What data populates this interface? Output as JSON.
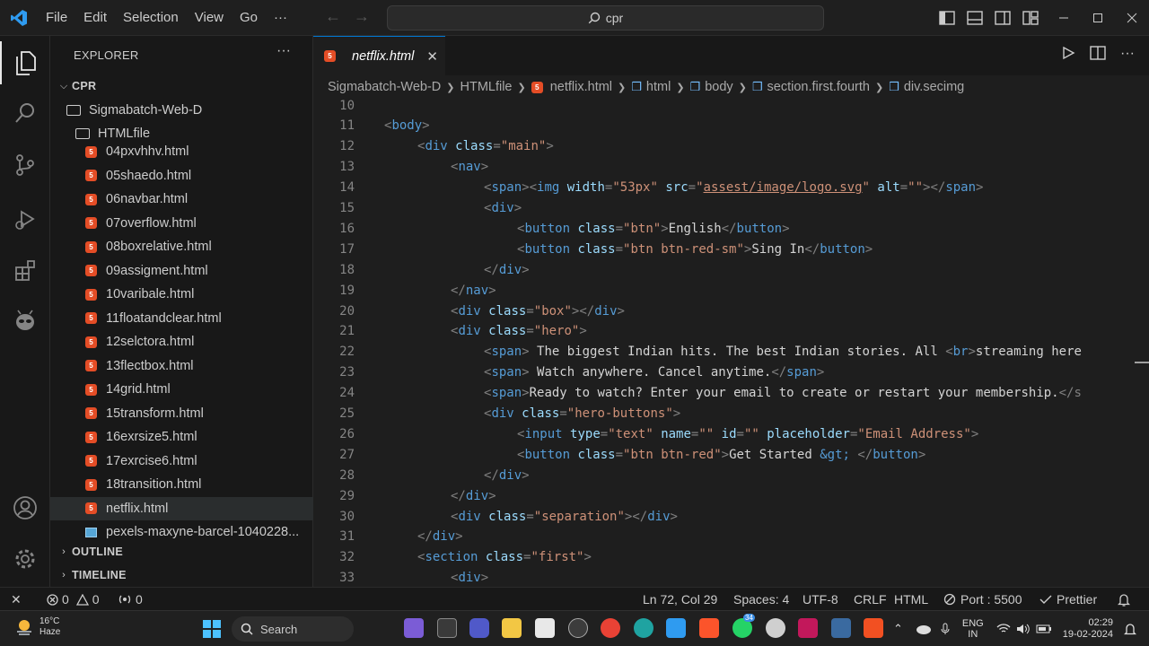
{
  "titlebar": {
    "menu": [
      "File",
      "Edit",
      "Selection",
      "View",
      "Go",
      "···"
    ],
    "search_text": "cpr",
    "back_glyph": "←",
    "forward_glyph": "→"
  },
  "sidebar": {
    "title": "EXPLORER",
    "more_glyph": "···",
    "root": "CPR",
    "folder": "Sigmabatch-Web-D",
    "subfolder": "HTMLfile",
    "files": [
      "04pxvhhv.html",
      "05shaedo.html",
      "06navbar.html",
      "07overflow.html",
      "08boxrelative.html",
      "09assigment.html",
      "10varibale.html",
      "11floatandclear.html",
      "12selctora.html",
      "13flectbox.html",
      "14grid.html",
      "15transform.html",
      "16exrsize5.html",
      "17exrcise6.html",
      "18transition.html",
      "netflix.html"
    ],
    "image_file": "pexels-maxyne-barcel-1040228...",
    "outline": "OUTLINE",
    "timeline": "TIMELINE"
  },
  "editor": {
    "tab_name": "netflix.html",
    "tab_close": "✕",
    "breadcrumb": [
      "Sigmabatch-Web-D",
      "HTMLfile",
      "netflix.html",
      "html",
      "body",
      "section.first.fourth",
      "div.secimg"
    ],
    "lines": [
      {
        "n": "10",
        "indent": 0,
        "segs": []
      },
      {
        "n": "11",
        "indent": 0,
        "segs": [
          [
            "p",
            "<"
          ],
          [
            "t",
            "body"
          ],
          [
            "p",
            ">"
          ]
        ]
      },
      {
        "n": "12",
        "indent": 1,
        "segs": [
          [
            "p",
            "<"
          ],
          [
            "t",
            "div"
          ],
          [
            "w",
            " "
          ],
          [
            "a",
            "class"
          ],
          [
            "p",
            "="
          ],
          [
            "s",
            "\"main\""
          ],
          [
            "p",
            ">"
          ]
        ]
      },
      {
        "n": "13",
        "indent": 2,
        "segs": [
          [
            "p",
            "<"
          ],
          [
            "t",
            "nav"
          ],
          [
            "p",
            ">"
          ]
        ]
      },
      {
        "n": "14",
        "indent": 3,
        "segs": [
          [
            "p",
            "<"
          ],
          [
            "t",
            "span"
          ],
          [
            "p",
            "><"
          ],
          [
            "t",
            "img"
          ],
          [
            "w",
            " "
          ],
          [
            "a",
            "width"
          ],
          [
            "p",
            "="
          ],
          [
            "s",
            "\"53px\""
          ],
          [
            "w",
            " "
          ],
          [
            "a",
            "src"
          ],
          [
            "p",
            "="
          ],
          [
            "s",
            "\""
          ],
          [
            "u",
            "assest/image/logo.svg"
          ],
          [
            "s",
            "\""
          ],
          [
            "w",
            " "
          ],
          [
            "a",
            "alt"
          ],
          [
            "p",
            "="
          ],
          [
            "s",
            "\"\""
          ],
          [
            "p",
            "></"
          ],
          [
            "t",
            "span"
          ],
          [
            "p",
            ">"
          ]
        ]
      },
      {
        "n": "15",
        "indent": 3,
        "segs": [
          [
            "p",
            "<"
          ],
          [
            "t",
            "div"
          ],
          [
            "p",
            ">"
          ]
        ]
      },
      {
        "n": "16",
        "indent": 4,
        "segs": [
          [
            "p",
            "<"
          ],
          [
            "t",
            "button"
          ],
          [
            "w",
            " "
          ],
          [
            "a",
            "class"
          ],
          [
            "p",
            "="
          ],
          [
            "s",
            "\"btn\""
          ],
          [
            "p",
            ">"
          ],
          [
            "w",
            "English"
          ],
          [
            "p",
            "</"
          ],
          [
            "t",
            "button"
          ],
          [
            "p",
            ">"
          ]
        ]
      },
      {
        "n": "17",
        "indent": 4,
        "segs": [
          [
            "p",
            "<"
          ],
          [
            "t",
            "button"
          ],
          [
            "w",
            " "
          ],
          [
            "a",
            "class"
          ],
          [
            "p",
            "="
          ],
          [
            "s",
            "\"btn btn-red-sm\""
          ],
          [
            "p",
            ">"
          ],
          [
            "w",
            "Sing In"
          ],
          [
            "p",
            "</"
          ],
          [
            "t",
            "button"
          ],
          [
            "p",
            ">"
          ]
        ]
      },
      {
        "n": "18",
        "indent": 3,
        "segs": [
          [
            "p",
            "</"
          ],
          [
            "t",
            "div"
          ],
          [
            "p",
            ">"
          ]
        ]
      },
      {
        "n": "19",
        "indent": 2,
        "segs": [
          [
            "p",
            "</"
          ],
          [
            "t",
            "nav"
          ],
          [
            "p",
            ">"
          ]
        ]
      },
      {
        "n": "20",
        "indent": 2,
        "segs": [
          [
            "p",
            "<"
          ],
          [
            "t",
            "div"
          ],
          [
            "w",
            " "
          ],
          [
            "a",
            "class"
          ],
          [
            "p",
            "="
          ],
          [
            "s",
            "\"box\""
          ],
          [
            "p",
            "></"
          ],
          [
            "t",
            "div"
          ],
          [
            "p",
            ">"
          ]
        ]
      },
      {
        "n": "21",
        "indent": 2,
        "segs": [
          [
            "p",
            "<"
          ],
          [
            "t",
            "div"
          ],
          [
            "w",
            " "
          ],
          [
            "a",
            "class"
          ],
          [
            "p",
            "="
          ],
          [
            "s",
            "\"hero\""
          ],
          [
            "p",
            ">"
          ]
        ]
      },
      {
        "n": "22",
        "indent": 3,
        "segs": [
          [
            "p",
            "<"
          ],
          [
            "t",
            "span"
          ],
          [
            "p",
            ">"
          ],
          [
            "w",
            " The biggest Indian hits. The best Indian stories. All "
          ],
          [
            "p",
            "<"
          ],
          [
            "t",
            "br"
          ],
          [
            "p",
            ">"
          ],
          [
            "w",
            "streaming here"
          ]
        ]
      },
      {
        "n": "23",
        "indent": 3,
        "segs": [
          [
            "p",
            "<"
          ],
          [
            "t",
            "span"
          ],
          [
            "p",
            ">"
          ],
          [
            "w",
            " Watch anywhere. Cancel anytime."
          ],
          [
            "p",
            "</"
          ],
          [
            "t",
            "span"
          ],
          [
            "p",
            ">"
          ]
        ]
      },
      {
        "n": "24",
        "indent": 3,
        "segs": [
          [
            "p",
            "<"
          ],
          [
            "t",
            "span"
          ],
          [
            "p",
            ">"
          ],
          [
            "w",
            "Ready to watch? Enter your email to create or restart your membership."
          ],
          [
            "p",
            "</s"
          ]
        ]
      },
      {
        "n": "25",
        "indent": 3,
        "segs": [
          [
            "p",
            "<"
          ],
          [
            "t",
            "div"
          ],
          [
            "w",
            " "
          ],
          [
            "a",
            "class"
          ],
          [
            "p",
            "="
          ],
          [
            "s",
            "\"hero-buttons\""
          ],
          [
            "p",
            ">"
          ]
        ]
      },
      {
        "n": "26",
        "indent": 4,
        "segs": [
          [
            "p",
            "<"
          ],
          [
            "t",
            "input"
          ],
          [
            "w",
            " "
          ],
          [
            "a",
            "type"
          ],
          [
            "p",
            "="
          ],
          [
            "s",
            "\"text\""
          ],
          [
            "w",
            " "
          ],
          [
            "a",
            "name"
          ],
          [
            "p",
            "="
          ],
          [
            "s",
            "\"\""
          ],
          [
            "w",
            " "
          ],
          [
            "a",
            "id"
          ],
          [
            "p",
            "="
          ],
          [
            "s",
            "\"\""
          ],
          [
            "w",
            " "
          ],
          [
            "a",
            "placeholder"
          ],
          [
            "p",
            "="
          ],
          [
            "s",
            "\"Email Address\""
          ],
          [
            "p",
            ">"
          ]
        ]
      },
      {
        "n": "27",
        "indent": 4,
        "segs": [
          [
            "p",
            "<"
          ],
          [
            "t",
            "button"
          ],
          [
            "w",
            " "
          ],
          [
            "a",
            "class"
          ],
          [
            "p",
            "="
          ],
          [
            "s",
            "\"btn btn-red\""
          ],
          [
            "p",
            ">"
          ],
          [
            "w",
            "Get Started "
          ],
          [
            "e",
            "&gt;"
          ],
          [
            "w",
            " "
          ],
          [
            "p",
            "</"
          ],
          [
            "t",
            "button"
          ],
          [
            "p",
            ">"
          ]
        ]
      },
      {
        "n": "28",
        "indent": 3,
        "segs": [
          [
            "p",
            "</"
          ],
          [
            "t",
            "div"
          ],
          [
            "p",
            ">"
          ]
        ]
      },
      {
        "n": "29",
        "indent": 2,
        "segs": [
          [
            "p",
            "</"
          ],
          [
            "t",
            "div"
          ],
          [
            "p",
            ">"
          ]
        ]
      },
      {
        "n": "30",
        "indent": 2,
        "segs": [
          [
            "p",
            "<"
          ],
          [
            "t",
            "div"
          ],
          [
            "w",
            " "
          ],
          [
            "a",
            "class"
          ],
          [
            "p",
            "="
          ],
          [
            "s",
            "\"separation\""
          ],
          [
            "p",
            "></"
          ],
          [
            "t",
            "div"
          ],
          [
            "p",
            ">"
          ]
        ]
      },
      {
        "n": "31",
        "indent": 1,
        "segs": [
          [
            "p",
            "</"
          ],
          [
            "t",
            "div"
          ],
          [
            "p",
            ">"
          ]
        ]
      },
      {
        "n": "32",
        "indent": 1,
        "segs": [
          [
            "p",
            "<"
          ],
          [
            "t",
            "section"
          ],
          [
            "w",
            " "
          ],
          [
            "a",
            "class"
          ],
          [
            "p",
            "="
          ],
          [
            "s",
            "\"first\""
          ],
          [
            "p",
            ">"
          ]
        ]
      },
      {
        "n": "33",
        "indent": 2,
        "segs": [
          [
            "p",
            "<"
          ],
          [
            "t",
            "div"
          ],
          [
            "p",
            ">"
          ]
        ]
      }
    ]
  },
  "statusbar": {
    "remote_glyph": "✕",
    "errors": "0",
    "warnings": "0",
    "ports": "0",
    "position": "Ln 72, Col 29",
    "spaces": "Spaces: 4",
    "encoding": "UTF-8",
    "eol": "CRLF",
    "language": "HTML",
    "port": "Port : 5500",
    "prettier": "Prettier"
  },
  "taskbar": {
    "temp": "16°C",
    "weather": "Haze",
    "search": "Search",
    "lang1": "ENG",
    "lang2": "IN",
    "time": "02:29",
    "date": "19-02-2024",
    "badge": "34"
  },
  "colors": {
    "accent": "#0078d4",
    "tag": "#569cd6",
    "attr": "#9cdcfe",
    "string": "#ce9178",
    "punct": "#808080",
    "text": "#d4d4d4",
    "entity": "#569cd6"
  }
}
